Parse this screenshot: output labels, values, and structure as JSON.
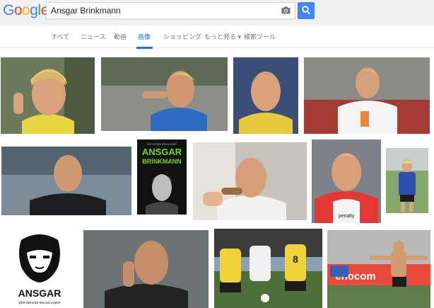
{
  "logo": {
    "letters": [
      "G",
      "o",
      "o",
      "g",
      "l",
      "e"
    ],
    "colors": [
      "#4285f4",
      "#ea4335",
      "#fbbc05",
      "#4285f4",
      "#34a853",
      "#ea4335"
    ]
  },
  "search": {
    "query": "Ansgar Brinkmann",
    "camera_icon": "camera-icon",
    "button_icon": "search-icon"
  },
  "tabs": [
    {
      "label": "すべて",
      "active": false
    },
    {
      "label": "ニュース",
      "active": false
    },
    {
      "label": "動画",
      "active": false
    },
    {
      "label": "画像",
      "active": true
    },
    {
      "label": "ショッピング",
      "active": false
    },
    {
      "label": "もっと見る ▾",
      "active": false
    },
    {
      "label": "検索ツール",
      "active": false
    }
  ],
  "book_cover": {
    "line1": "DER WEISSE BRASILIANER",
    "title1": "ANSGAR",
    "title2": "BRINKMANN"
  },
  "stencil_art": {
    "title": "ANSGAR",
    "subtitle": "DER WEISSE BRASILIANER"
  },
  "jersey_text": {
    "sponsor": "penalty",
    "number": "8"
  },
  "banner_text": {
    "text": "enocom"
  },
  "accent": "#1a73e8"
}
